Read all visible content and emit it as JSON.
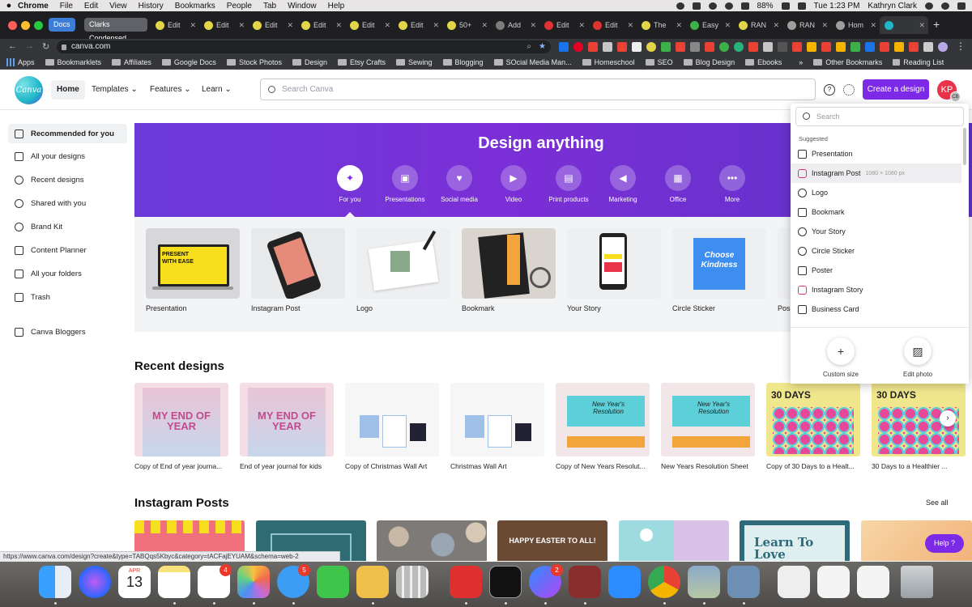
{
  "macbar": {
    "app": "Chrome",
    "menus": [
      "File",
      "Edit",
      "View",
      "History",
      "Bookmarks",
      "People",
      "Tab",
      "Window",
      "Help"
    ],
    "battery": "88%",
    "clock": "Tue 1:23 PM",
    "user": "Kathryn Clark"
  },
  "tabs": {
    "group_docs": "Docs",
    "group_clarks": "Clarks Condensed",
    "items": [
      "Edit",
      "Edit",
      "Edit",
      "Edit",
      "Edit",
      "Edit",
      "50+",
      "Add",
      "Edit",
      "Edit",
      "The",
      "Easy",
      "RAN",
      "RAN",
      "Hom"
    ]
  },
  "toolbar": {
    "url": "canva.com"
  },
  "bookmarks": [
    "Apps",
    "Bookmarklets",
    "Affiliates",
    "Google Docs",
    "Stock Photos",
    "Design",
    "Etsy Crafts",
    "Sewing",
    "Blogging",
    "SOcial Media Man...",
    "Homeschool",
    "SEO",
    "Blog Design",
    "Ebooks",
    "Other Bookmarks",
    "Reading List"
  ],
  "header": {
    "logo": "Canva",
    "nav": [
      "Home",
      "Templates",
      "Features",
      "Learn"
    ],
    "search_placeholder": "Search Canva",
    "create_label": "Create a design",
    "avatar_initials": "KP",
    "avatar_sub": "CB"
  },
  "sidebar": {
    "items": [
      "Recommended for you",
      "All your designs",
      "Recent designs",
      "Shared with you",
      "Brand Kit",
      "Content Planner",
      "All your folders",
      "Trash",
      "Canva Bloggers"
    ]
  },
  "hero": {
    "title": "Design anything",
    "categories": [
      "For you",
      "Presentations",
      "Social media",
      "Video",
      "Print products",
      "Marketing",
      "Office",
      "More"
    ]
  },
  "templates": [
    {
      "label": "Presentation",
      "thumb_text": "PRESENT WITH EASE"
    },
    {
      "label": "Instagram Post",
      "thumb_text": ""
    },
    {
      "label": "Logo",
      "thumb_text": ""
    },
    {
      "label": "Bookmark",
      "thumb_text": ""
    },
    {
      "label": "Your Story",
      "thumb_text": ""
    },
    {
      "label": "Circle Sticker",
      "thumb_text": "Choose Kindness"
    },
    {
      "label": "Pos",
      "thumb_text": ""
    }
  ],
  "recent": {
    "title": "Recent designs",
    "items": [
      "Copy of End of year journa...",
      "End of year journal for kids",
      "Copy of Christmas Wall Art",
      "Christmas Wall Art",
      "Copy of New Years Resolut...",
      "New Years Resolution Sheet",
      "Copy of 30 Days to a Healt...",
      "30 Days to a Healthier ..."
    ],
    "thumb_texts": [
      "MY END OF YEAR",
      "MY END OF YEAR",
      "",
      "",
      "New Year's Resolution",
      "New Year's Resolution",
      "30 DAYS",
      "30 DAYS"
    ]
  },
  "instagram": {
    "title": "Instagram Posts",
    "see_all": "See all",
    "thumb_texts": [
      "",
      "",
      "",
      "HAPPY EASTER TO ALL!",
      "",
      "Learn To Love",
      ""
    ]
  },
  "dropdown": {
    "search_placeholder": "Search",
    "subtitle": "Suggested",
    "items": [
      {
        "label": "Presentation",
        "meta": ""
      },
      {
        "label": "Instagram Post",
        "meta": "1080 × 1080 px"
      },
      {
        "label": "Logo",
        "meta": ""
      },
      {
        "label": "Bookmark",
        "meta": ""
      },
      {
        "label": "Your Story",
        "meta": ""
      },
      {
        "label": "Circle Sticker",
        "meta": ""
      },
      {
        "label": "Poster",
        "meta": ""
      },
      {
        "label": "Instagram Story",
        "meta": ""
      },
      {
        "label": "Business Card",
        "meta": ""
      }
    ],
    "custom_size": "Custom size",
    "edit_photo": "Edit photo"
  },
  "help_label": "Help ?",
  "status_url": "https://www.canva.com/design?create&type=TABQqs5Kbyc&category=tACFajEYUAM&schema=web-2",
  "dock": {
    "calendar_month": "APR",
    "calendar_day": "13",
    "badges": [
      "4",
      "5",
      "2"
    ]
  },
  "colors": {
    "canva_purple": "#7d2ae8",
    "avatar_red": "#e8334a",
    "hero_purple": "#6c3ad9"
  }
}
